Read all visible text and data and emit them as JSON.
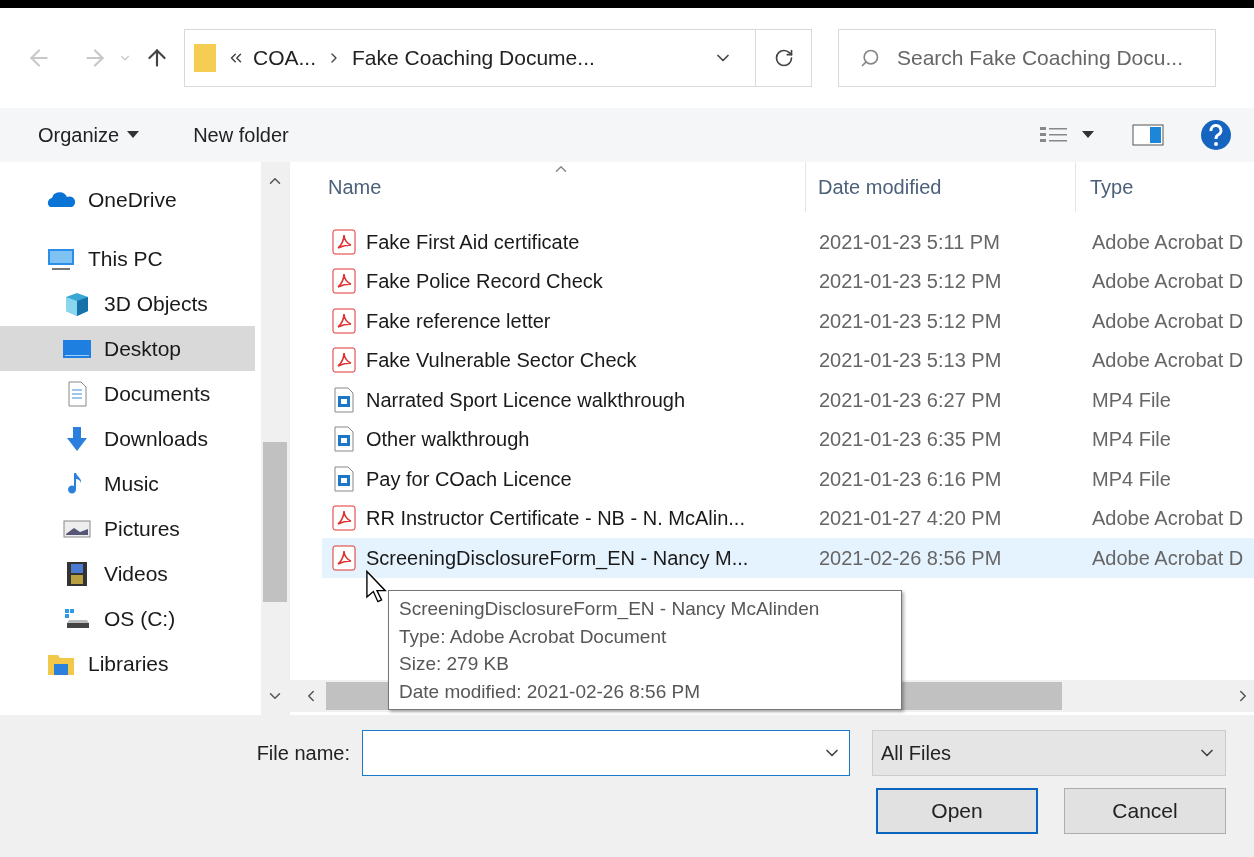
{
  "nav": {
    "breadcrumb": [
      "COA...",
      "Fake Coaching Docume..."
    ],
    "search": {
      "placeholder": "Search Fake Coaching Docu..."
    }
  },
  "toolbar": {
    "organize": "Organize",
    "new_folder": "New folder"
  },
  "sidebar": {
    "items": [
      {
        "kind": "cloud",
        "label": "OneDrive",
        "selected": false
      },
      {
        "kind": "pc",
        "label": "This PC",
        "selected": false,
        "children": [
          {
            "kind": "cube",
            "label": "3D Objects",
            "selected": false
          },
          {
            "kind": "desktop",
            "label": "Desktop",
            "selected": true
          },
          {
            "kind": "documents",
            "label": "Documents",
            "selected": false
          },
          {
            "kind": "download",
            "label": "Downloads",
            "selected": false
          },
          {
            "kind": "music",
            "label": "Music",
            "selected": false
          },
          {
            "kind": "pictures",
            "label": "Pictures",
            "selected": false
          },
          {
            "kind": "videos",
            "label": "Videos",
            "selected": false
          },
          {
            "kind": "drive",
            "label": "OS (C:)",
            "selected": false
          }
        ]
      },
      {
        "kind": "libraries",
        "label": "Libraries",
        "selected": false
      }
    ]
  },
  "columns": [
    "Name",
    "Date modified",
    "Type"
  ],
  "files": [
    {
      "kind": "pdf",
      "name": "Fake First Aid certificate",
      "date": "2021-01-23 5:11 PM",
      "type": "Adobe Acrobat D",
      "selected": false
    },
    {
      "kind": "pdf",
      "name": "Fake Police Record Check",
      "date": "2021-01-23 5:12 PM",
      "type": "Adobe Acrobat D",
      "selected": false
    },
    {
      "kind": "pdf",
      "name": "Fake reference letter",
      "date": "2021-01-23 5:12 PM",
      "type": "Adobe Acrobat D",
      "selected": false
    },
    {
      "kind": "pdf",
      "name": "Fake Vulnerable Sector Check",
      "date": "2021-01-23 5:13 PM",
      "type": "Adobe Acrobat D",
      "selected": false
    },
    {
      "kind": "video",
      "name": "Narrated Sport Licence walkthrough",
      "date": "2021-01-23 6:27 PM",
      "type": "MP4 File",
      "selected": false
    },
    {
      "kind": "video",
      "name": "Other walkthrough",
      "date": "2021-01-23 6:35 PM",
      "type": "MP4 File",
      "selected": false
    },
    {
      "kind": "video",
      "name": "Pay for COach Licence",
      "date": "2021-01-23 6:16 PM",
      "type": "MP4 File",
      "selected": false
    },
    {
      "kind": "pdf",
      "name": "RR Instructor Certificate - NB - N. McAlin...",
      "date": "2021-01-27 4:20 PM",
      "type": "Adobe Acrobat D",
      "selected": false
    },
    {
      "kind": "pdf",
      "name": "ScreeningDisclosureForm_EN - Nancy M...",
      "date": "2021-02-26 8:56 PM",
      "type": "Adobe Acrobat D",
      "selected": true
    }
  ],
  "tooltip": {
    "lines": [
      "ScreeningDisclosureForm_EN - Nancy McAlinden",
      "Type: Adobe Acrobat Document",
      "Size: 279 KB",
      "Date modified: 2021-02-26 8:56 PM"
    ]
  },
  "file_name": {
    "label": "File name:"
  },
  "filter": {
    "value": "All Files"
  },
  "buttons": [
    {
      "label": "Open",
      "default": true
    },
    {
      "label": "Cancel",
      "default": false
    }
  ]
}
